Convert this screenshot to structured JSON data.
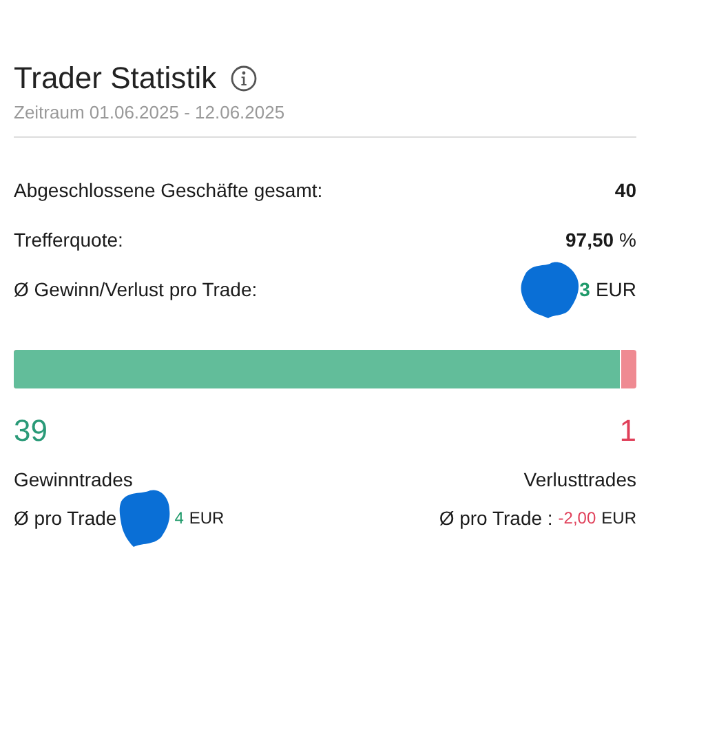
{
  "header": {
    "title": "Trader Statistik",
    "period": "Zeitraum 01.06.2025 - 12.06.2025"
  },
  "stats": [
    {
      "label": "Abgeschlossene Geschäfte gesamt:",
      "value": "40",
      "kind": "count"
    },
    {
      "label": "Trefferquote:",
      "value": "97,50",
      "unit": "%",
      "kind": "percent"
    },
    {
      "label": "Ø Gewinn/Verlust pro Trade:",
      "value": "3",
      "unit": "EUR",
      "kind": "money",
      "redacted": true
    }
  ],
  "ratio_bar": {
    "level": 0.975
  },
  "wins": {
    "count": "39",
    "label": "Gewinntrades",
    "avg_label": "Ø pro Trade",
    "avg_value": "4",
    "unit": "EUR",
    "redacted": true
  },
  "losses": {
    "count": "1",
    "label": "Verlusttrades",
    "avg_label": "Ø pro Trade :",
    "avg_value": "-2,00",
    "unit": "EUR"
  }
}
